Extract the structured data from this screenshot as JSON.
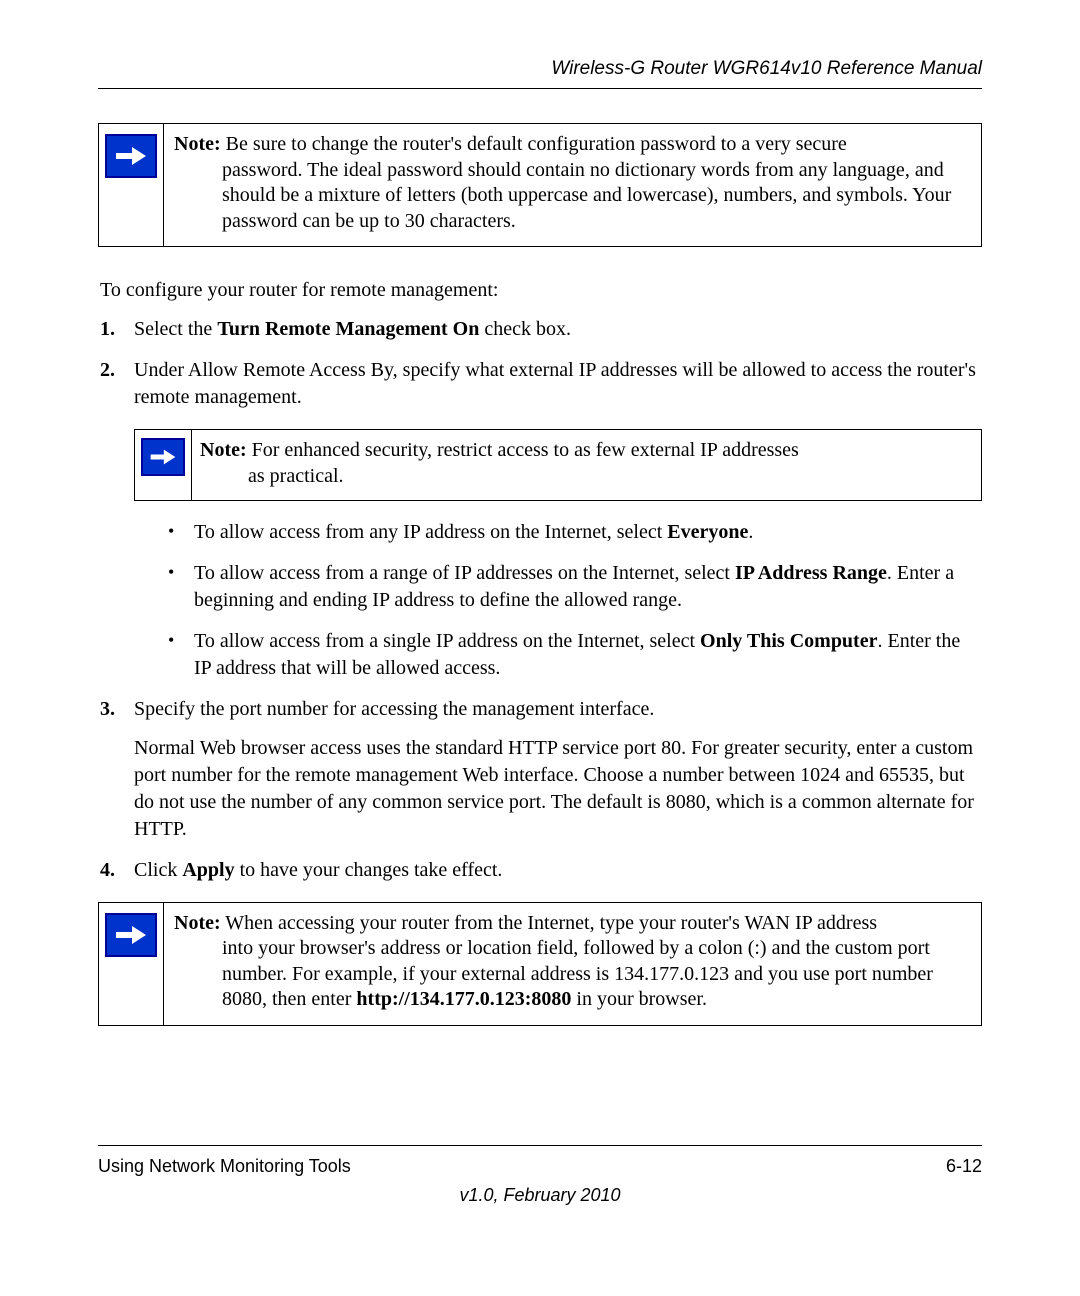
{
  "header": {
    "title": "Wireless-G Router WGR614v10 Reference Manual"
  },
  "note1": {
    "label": "Note:",
    "text_line": " Be sure to change the router's default configuration password to a very secure ",
    "text_rest": "password. The ideal password should contain no dictionary words from any language, and should be a mixture of letters (both uppercase and lowercase), numbers, and symbols. Your password can be up to 30 characters."
  },
  "intro": "To configure your router for remote management:",
  "steps": {
    "s1_pre": "Select the ",
    "s1_bold": "Turn Remote Management On",
    "s1_post": " check box.",
    "s2": "Under Allow Remote Access By, specify what external IP addresses will be allowed to access the router's remote management.",
    "s2_note_label": "Note:",
    "s2_note_line": " For enhanced security, restrict access to as few external IP addresses ",
    "s2_note_rest": "as practical.",
    "s2_b1_pre": "To allow access from any IP address on the Internet, select ",
    "s2_b1_bold": "Everyone",
    "s2_b1_post": ".",
    "s2_b2_pre": "To allow access from a range of IP addresses on the Internet, select ",
    "s2_b2_bold": "IP Address Range",
    "s2_b2_post": ". Enter a beginning and ending IP address to define the allowed range.",
    "s2_b3_pre": "To allow access from a single IP address on the Internet, select ",
    "s2_b3_bold": "Only This Computer",
    "s2_b3_post": ". Enter the IP address that will be allowed access.",
    "s3": "Specify the port number for accessing the management interface.",
    "s3_para": "Normal Web browser access uses the standard HTTP service port 80. For greater security, enter a custom port number for the remote management Web interface. Choose a number between 1024 and 65535, but do not use the number of any common service port. The default is 8080, which is a common alternate for HTTP.",
    "s4_pre": "Click ",
    "s4_bold": "Apply",
    "s4_post": " to have your changes take effect."
  },
  "note2": {
    "label": "Note:",
    "text_line": " When accessing your router from the Internet, type your router's WAN IP address ",
    "text_rest_a": "into your browser's address or location field, followed by a colon (:) and the custom port number. For example, if your external address is 134.177.0.123 and you use port number 8080, then enter ",
    "url_bold": "http://134.177.0.123:8080",
    "text_rest_b": " in your browser."
  },
  "footer": {
    "left": "Using Network Monitoring Tools",
    "right": "6-12",
    "version": "v1.0, February 2010"
  }
}
